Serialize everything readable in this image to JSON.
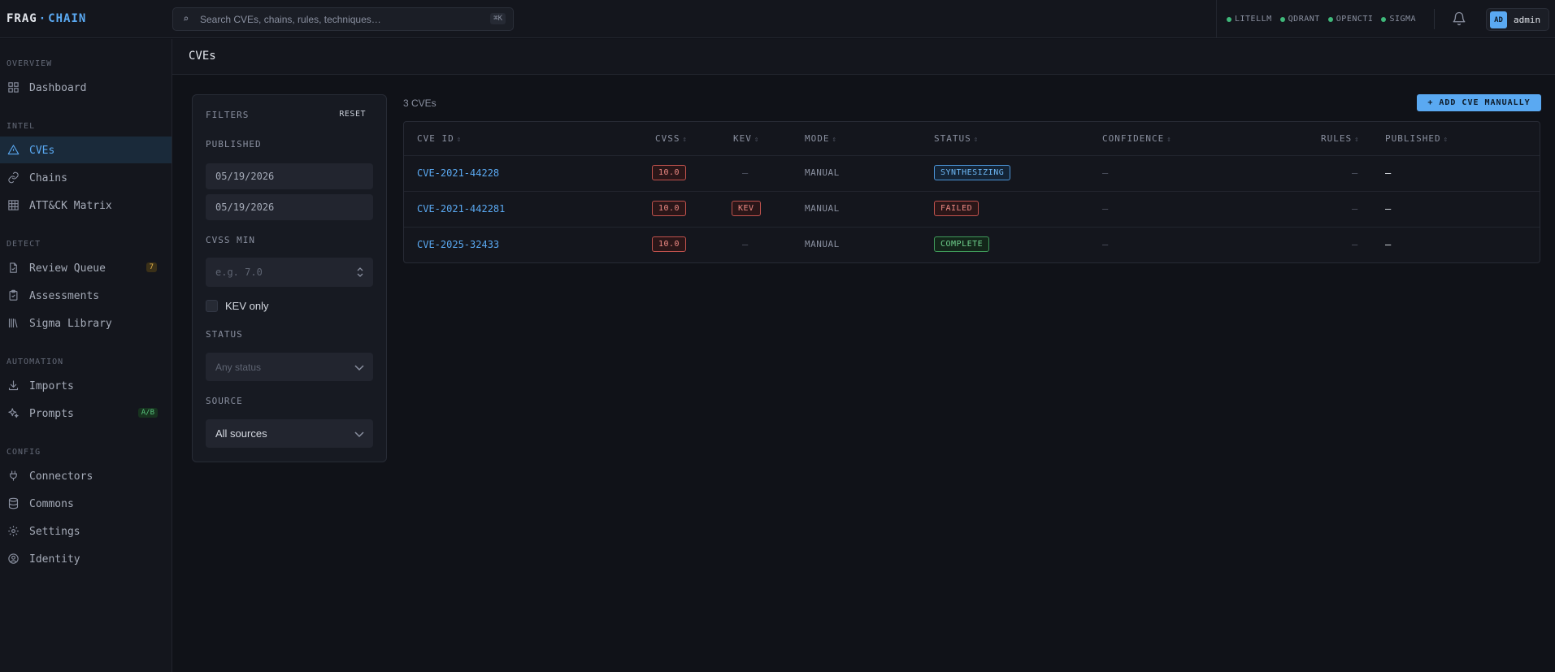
{
  "app": {
    "logo_left": "FRAG",
    "logo_sep": "·",
    "logo_right": "CHAIN",
    "accent": "#5aa9f2"
  },
  "search": {
    "icon": "search-icon",
    "placeholder": "Search CVEs, chains, rules, techniques…",
    "shortcut": "⌘K"
  },
  "services": [
    "LITELLM",
    "QDRANT",
    "OPENCTI",
    "SIGMA"
  ],
  "service_status_color": "#3fb87a",
  "user": {
    "initials": "AD",
    "name": "admin"
  },
  "sidebar": {
    "sections": [
      {
        "title": "OVERVIEW",
        "items": [
          {
            "label": "Dashboard",
            "icon": "grid-icon"
          }
        ]
      },
      {
        "title": "INTEL",
        "items": [
          {
            "label": "CVEs",
            "icon": "warning-triangle-icon",
            "active": true
          },
          {
            "label": "Chains",
            "icon": "link-icon"
          },
          {
            "label": "ATT&CK Matrix",
            "icon": "table-icon"
          }
        ]
      },
      {
        "title": "DETECT",
        "items": [
          {
            "label": "Review Queue",
            "icon": "file-check-icon",
            "badge": "7"
          },
          {
            "label": "Assessments",
            "icon": "clipboard-check-icon"
          },
          {
            "label": "Sigma Library",
            "icon": "library-icon"
          }
        ]
      },
      {
        "title": "AUTOMATION",
        "items": [
          {
            "label": "Imports",
            "icon": "download-icon"
          },
          {
            "label": "Prompts",
            "icon": "sparkles-icon",
            "badge": "A/B"
          }
        ]
      },
      {
        "title": "CONFIG",
        "items": [
          {
            "label": "Connectors",
            "icon": "plug-icon"
          },
          {
            "label": "Commons",
            "icon": "database-icon"
          },
          {
            "label": "Settings",
            "icon": "gear-icon"
          },
          {
            "label": "Identity",
            "icon": "user-circle-icon"
          }
        ]
      }
    ]
  },
  "page": {
    "title": "CVEs"
  },
  "filters": {
    "title": "FILTERS",
    "reset": "RESET",
    "published_label": "PUBLISHED",
    "published_from": {
      "mm": "05",
      "dd": "19",
      "yyyy": "2026"
    },
    "published_to": {
      "mm": "05",
      "dd": "19",
      "yyyy": "2026"
    },
    "cvss_label": "CVSS MIN",
    "cvss_placeholder": "e.g. 7.0",
    "kev_label": "KEV only",
    "kev_checked": false,
    "status_label": "STATUS",
    "status_placeholder": "Any status",
    "source_label": "SOURCE",
    "source_value": "All sources"
  },
  "list": {
    "count": "3 CVEs",
    "add_button": "+ ADD CVE MANUALLY",
    "columns": [
      "CVE ID",
      "CVSS",
      "KEV",
      "MODE",
      "STATUS",
      "CONFIDENCE",
      "RULES",
      "PUBLISHED"
    ],
    "sort_glyph": "⇕",
    "rows": [
      {
        "id": "CVE-2021-44228",
        "cvss": "10.0",
        "kev": "—",
        "mode": "MANUAL",
        "status": "SYNTHESIZING",
        "confidence": "—",
        "rules": "—",
        "published": "—"
      },
      {
        "id": "CVE-2021-442281",
        "cvss": "10.0",
        "kev": "KEV",
        "mode": "MANUAL",
        "status": "FAILED",
        "confidence": "—",
        "rules": "—",
        "published": "—"
      },
      {
        "id": "CVE-2025-32433",
        "cvss": "10.0",
        "kev": "—",
        "mode": "MANUAL",
        "status": "COMPLETE",
        "confidence": "—",
        "rules": "—",
        "published": "—"
      }
    ]
  }
}
